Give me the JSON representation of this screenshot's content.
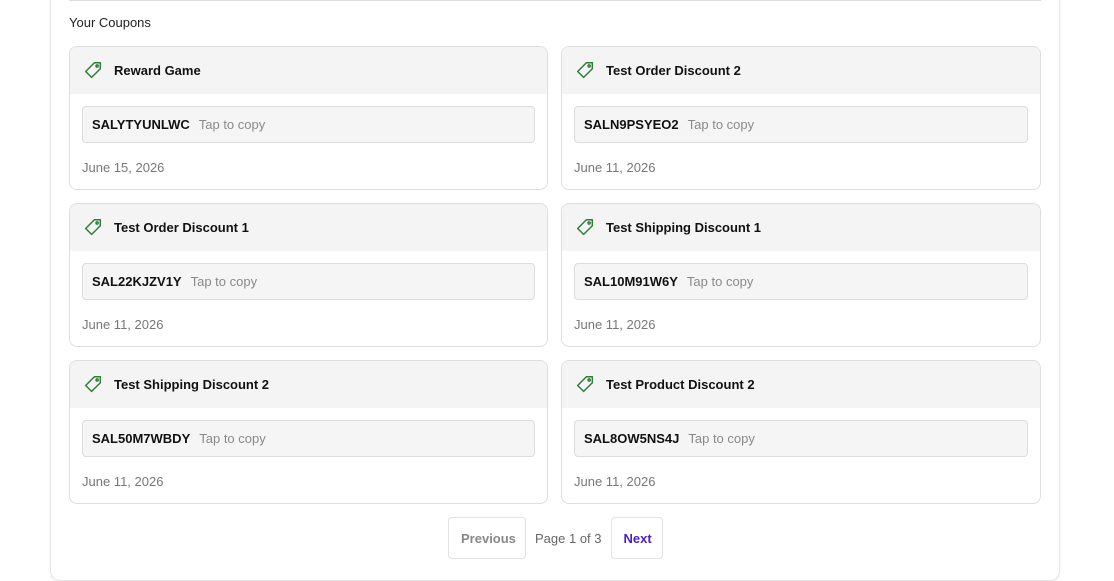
{
  "section": {
    "title": "Your Coupons"
  },
  "coupons": [
    {
      "title": "Reward Game",
      "code": "SALYTYUNLWC",
      "copy_hint": "Tap to copy",
      "date": "June 15, 2026"
    },
    {
      "title": "Test Order Discount 2",
      "code": "SALN9PSYEO2",
      "copy_hint": "Tap to copy",
      "date": "June 11, 2026"
    },
    {
      "title": "Test Order Discount 1",
      "code": "SAL22KJZV1Y",
      "copy_hint": "Tap to copy",
      "date": "June 11, 2026"
    },
    {
      "title": "Test Shipping Discount 1",
      "code": "SAL10M91W6Y",
      "copy_hint": "Tap to copy",
      "date": "June 11, 2026"
    },
    {
      "title": "Test Shipping Discount 2",
      "code": "SAL50M7WBDY",
      "copy_hint": "Tap to copy",
      "date": "June 11, 2026"
    },
    {
      "title": "Test Product Discount 2",
      "code": "SAL8OW5NS4J",
      "copy_hint": "Tap to copy",
      "date": "June 11, 2026"
    }
  ],
  "pagination": {
    "previous_label": "Previous",
    "page_info": "Page 1 of 3",
    "next_label": "Next"
  },
  "icons": {
    "coupon": "tag-icon"
  },
  "colors": {
    "tag_icon": "#2e7d3a",
    "next_link": "#4a1fc4"
  }
}
